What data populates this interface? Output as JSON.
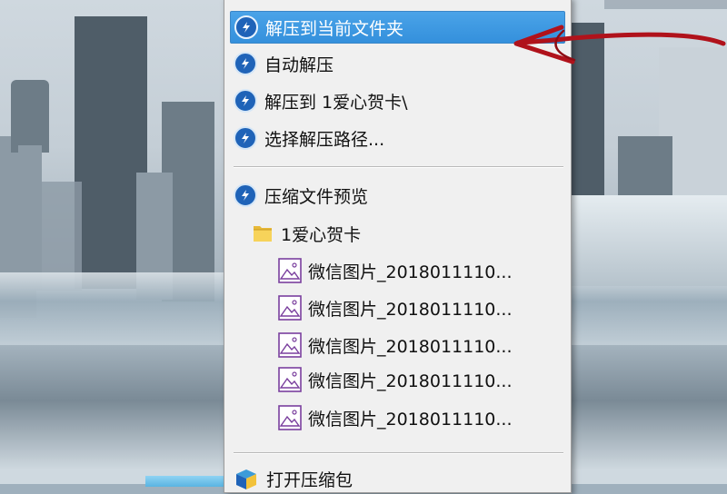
{
  "context_menu": {
    "items": [
      {
        "label": "解压到当前文件夹",
        "icon": "extract-icon",
        "selected": true
      },
      {
        "label": "自动解压",
        "icon": "extract-icon"
      },
      {
        "label": "解压到 1爱心贺卡\\",
        "icon": "extract-icon"
      },
      {
        "label": "选择解压路径...",
        "icon": "extract-icon"
      }
    ],
    "preview": {
      "label": "压缩文件预览",
      "icon": "extract-icon",
      "folder": {
        "label": "1爱心贺卡",
        "icon": "folder-icon"
      },
      "files": [
        {
          "label": "微信图片_2018011110...",
          "icon": "image-file-icon"
        },
        {
          "label": "微信图片_2018011110...",
          "icon": "image-file-icon"
        },
        {
          "label": "微信图片_2018011110...",
          "icon": "image-file-icon"
        },
        {
          "label": "微信图片_2018011110...",
          "icon": "image-file-icon"
        },
        {
          "label": "微信图片_2018011110...",
          "icon": "image-file-icon"
        }
      ]
    },
    "open_archive": {
      "label": "打开压缩包",
      "icon": "archive-app-icon"
    }
  },
  "colors": {
    "selection": "#3490dc",
    "menu_background": "#f0f0f0",
    "icon_blue": "#1f63b8",
    "annotation_red": "#b0121b"
  }
}
